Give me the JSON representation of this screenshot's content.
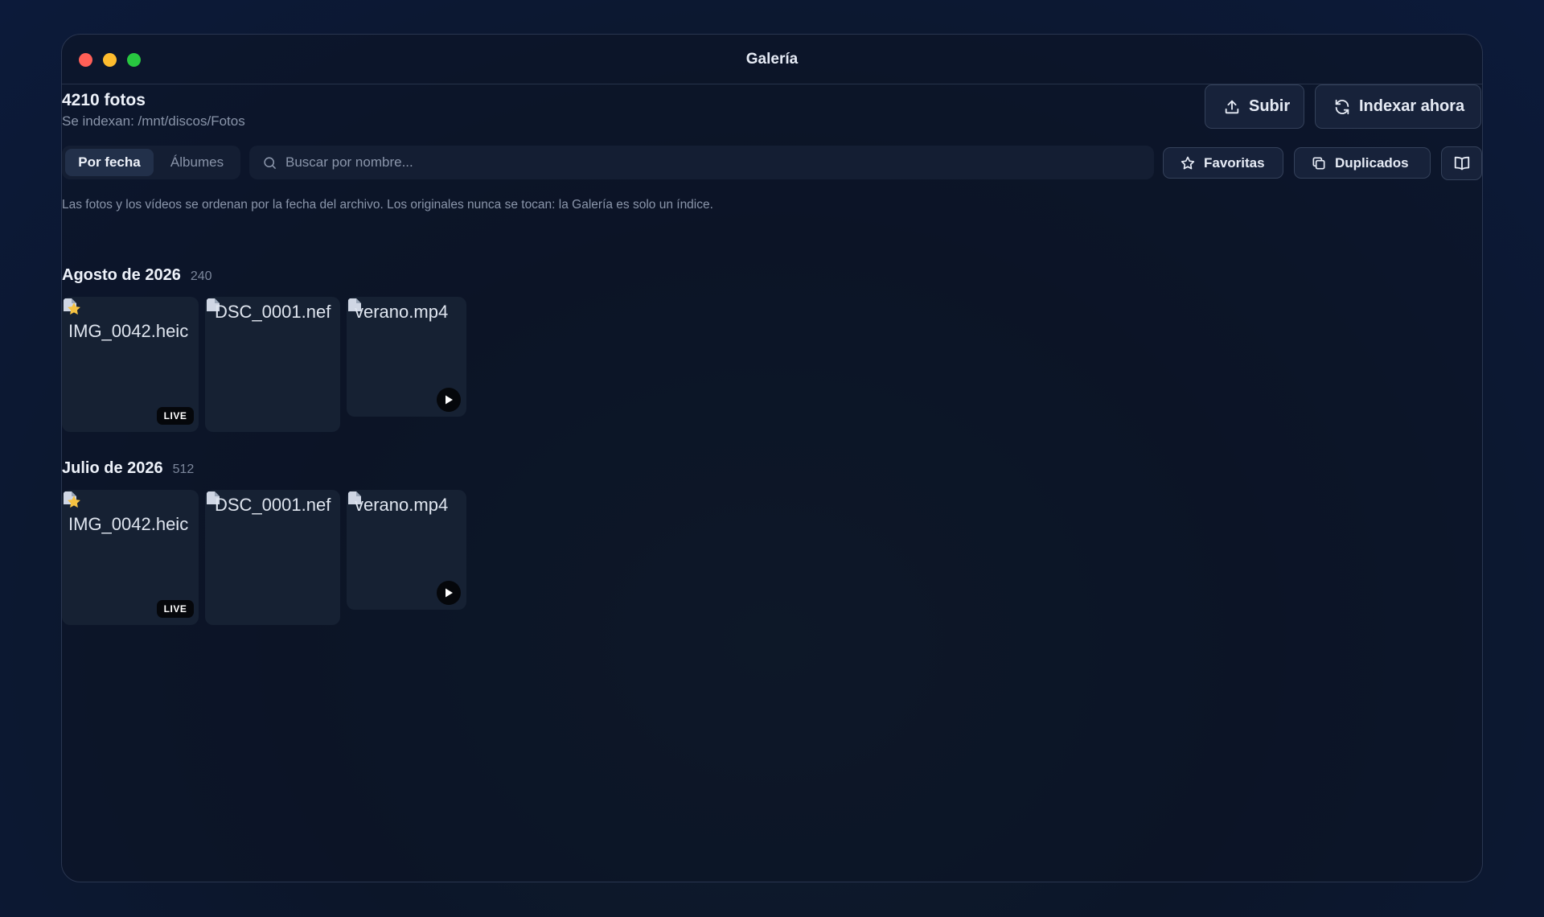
{
  "window": {
    "title": "Galería",
    "traffic_lights": {
      "close": "#ff5f57",
      "minimize": "#febc2e",
      "maximize": "#28c840"
    }
  },
  "header": {
    "count_title": "4210 fotos",
    "index_path": "Se indexan: /mnt/discos/Fotos",
    "upload_label": "Subir",
    "index_label": "Indexar ahora",
    "upload_icon": "upload-icon",
    "index_icon": "refresh-icon"
  },
  "toolbar": {
    "tabs": [
      {
        "label": "Por fecha",
        "active": true
      },
      {
        "label": "Álbumes",
        "active": false
      }
    ],
    "search_placeholder": "Buscar por nombre...",
    "search_value": "",
    "favorites_label": "Favoritas",
    "duplicates_label": "Duplicados",
    "favorites_icon": "star-icon",
    "duplicates_icon": "copy-icon",
    "view_icon": "book-icon"
  },
  "notice": "Las fotos y los vídeos se ordenan por la fecha del archivo. Los originales nunca se tocan: la Galería es solo un índice.",
  "sections": [
    {
      "title": "Agosto de 2026",
      "count": "240",
      "items": [
        {
          "name": "IMG_0042.heic",
          "badge": "LIVE",
          "favorite": true
        },
        {
          "name": "DSC_0001.nef"
        },
        {
          "name": "verano.mp4",
          "badge_icon": "play-icon"
        }
      ]
    },
    {
      "title": "Julio de 2026",
      "count": "512",
      "items": [
        {
          "name": "IMG_0042.heic",
          "badge": "LIVE",
          "favorite": true
        },
        {
          "name": "DSC_0001.nef"
        },
        {
          "name": "verano.mp4",
          "badge_icon": "play-icon"
        }
      ]
    }
  ],
  "colors": {
    "accent_star": "#f5c242",
    "background": "#0c1629",
    "card": "#162133"
  }
}
